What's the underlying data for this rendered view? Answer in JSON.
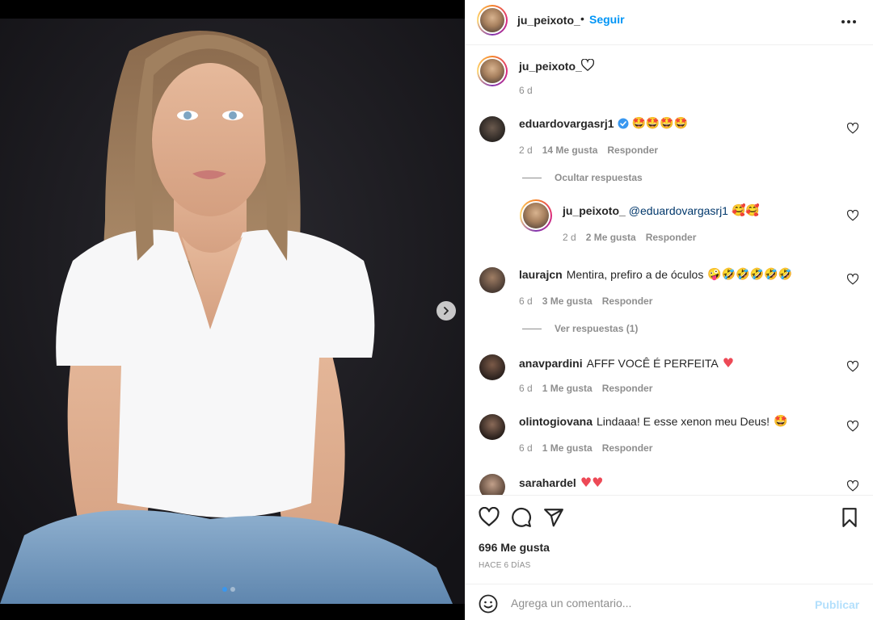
{
  "post": {
    "author": "ju_peixoto_",
    "separator": "•",
    "follow_label": "Seguir",
    "more_icon": "more-horizontal-icon",
    "caption_time": "6 d",
    "image_alt": "Photo of a woman with long hair wearing a white t-shirt and jeans",
    "carousel_dots": 2,
    "carousel_active": 0
  },
  "comments": [
    {
      "user": "eduardovargasrj1",
      "verified": true,
      "text": "",
      "emoji": "🤩🤩🤩🤩",
      "time": "2 d",
      "likes": "14 Me gusta",
      "reply": "Responder",
      "toggle": "Ocultar respuestas"
    },
    {
      "user": "ju_peixoto_",
      "mention": "@eduardovargasrj1",
      "emoji": "🥰🥰",
      "time": "2 d",
      "likes": "2 Me gusta",
      "reply": "Responder"
    },
    {
      "user": "laurajcn",
      "text": "Mentira, prefiro a de óculos",
      "emoji": "🤪🤣🤣🤣🤣🤣",
      "time": "6 d",
      "likes": "3 Me gusta",
      "reply": "Responder",
      "toggle": "Ver respuestas (1)"
    },
    {
      "user": "anavpardini",
      "text": "AFFF VOCÊ É PERFEITA",
      "emoji": "♥",
      "time": "6 d",
      "likes": "1 Me gusta",
      "reply": "Responder"
    },
    {
      "user": "olintogiovana",
      "text": "Lindaaa! E esse xenon meu Deus!",
      "emoji": "🤩",
      "time": "6 d",
      "likes": "1 Me gusta",
      "reply": "Responder"
    },
    {
      "user": "sarahardel",
      "text": "",
      "emoji": "♥♥"
    }
  ],
  "footer": {
    "likes": "696 Me gusta",
    "date": "HACE 6 DÍAS",
    "comment_placeholder": "Agrega un comentario...",
    "publish_label": "Publicar"
  },
  "colors": {
    "accent": "#0095f6",
    "verified": "#3897f0",
    "heart_red": "#ed4956",
    "muted": "#8e8e8e"
  }
}
